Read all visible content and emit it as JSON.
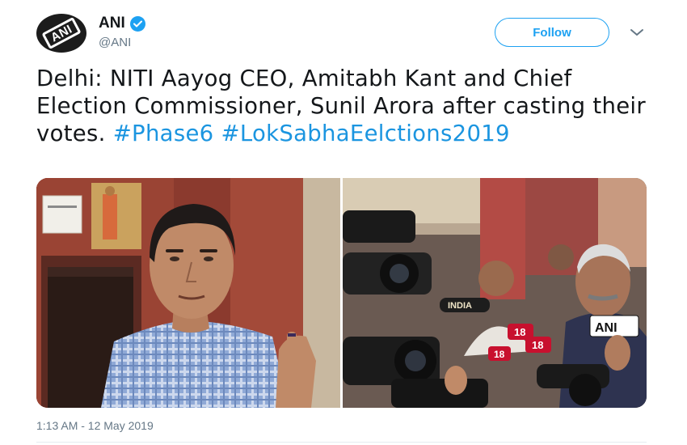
{
  "author": {
    "display_name": "ANI",
    "handle": "@ANI",
    "avatar_text": "ANI",
    "verified": true
  },
  "follow_label": "Follow",
  "tweet": {
    "text": "Delhi: NITI Aayog CEO, Amitabh Kant and Chief Election Commissioner, Sunil Arora after casting their votes.",
    "hashtags": [
      "#Phase6",
      "#LokSabhaEelctions2019"
    ]
  },
  "media": {
    "left_photo": {
      "description_icon": "man-showing-inked-finger-photo",
      "sign_text": ""
    },
    "right_photo": {
      "description_icon": "press-microphones-photo",
      "mic_labels": [
        "INDIA",
        "ANI",
        "18",
        "18",
        "18"
      ]
    }
  },
  "timestamp": "1:13 AM - 12 May 2019",
  "colors": {
    "accent": "#1da1f2",
    "hashtag": "#1b95e0",
    "secondary_text": "#657786"
  }
}
